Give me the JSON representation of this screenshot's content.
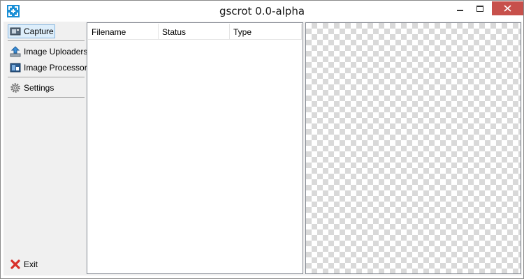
{
  "window": {
    "title": "gscrot 0.0-alpha",
    "accent_color": "#1a8fd6",
    "close_button_color": "#c7504b"
  },
  "sidebar": {
    "items": [
      {
        "label": "Capture",
        "icon": "camera-icon",
        "selected": true
      },
      {
        "label": "Image Uploaders",
        "icon": "upload-icon",
        "selected": false
      },
      {
        "label": "Image Processors",
        "icon": "image-processor-icon",
        "selected": false
      },
      {
        "label": "Settings",
        "icon": "gear-icon",
        "selected": false
      }
    ],
    "exit": {
      "label": "Exit",
      "icon": "red-x-icon"
    }
  },
  "filelist": {
    "columns": [
      "Filename",
      "Status",
      "Type"
    ],
    "rows": []
  },
  "preview": {
    "background": "transparency-checkerboard"
  }
}
